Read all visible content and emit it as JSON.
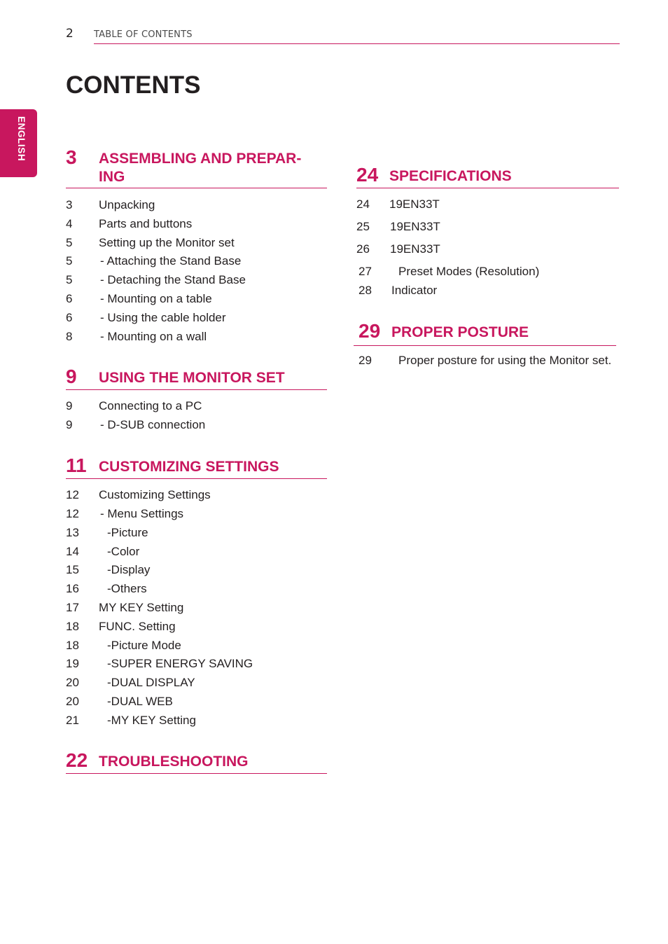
{
  "header": {
    "page_number": "2",
    "running_title": "TABLE OF CONTENTS"
  },
  "page_title": "CONTENTS",
  "language_tab": "ENGLISH",
  "accent_color": "#c8175e",
  "sections": [
    {
      "number": "3",
      "title_line1": "ASSEMBLING AND PREPAR-",
      "title_line2": "ING",
      "entries": [
        {
          "page": "3",
          "label": "Unpacking"
        },
        {
          "page": "4",
          "label": "Parts and buttons"
        },
        {
          "page": "5",
          "label": "Setting up the Monitor set"
        },
        {
          "page": "5",
          "label": "- Attaching the Stand Base"
        },
        {
          "page": "5",
          "label": "- Detaching the Stand Base"
        },
        {
          "page": "6",
          "label": "- Mounting on a table"
        },
        {
          "page": "6",
          "label": "- Using the cable holder"
        },
        {
          "page": "8",
          "label": "- Mounting on a wall"
        }
      ]
    },
    {
      "number": "9",
      "title_line1": "USING THE MONITOR SET",
      "entries": [
        {
          "page": "9",
          "label": "Connecting to a PC"
        },
        {
          "page": "9",
          "label": "- D-SUB connection"
        }
      ]
    },
    {
      "number": "11",
      "title_line1": "CUSTOMIZING SETTINGS",
      "entries": [
        {
          "page": "12",
          "label": "Customizing Settings"
        },
        {
          "page": "12",
          "label": "- Menu Settings"
        },
        {
          "page": "13",
          "label": "-Picture"
        },
        {
          "page": "14",
          "label": "-Color"
        },
        {
          "page": "15",
          "label": "-Display"
        },
        {
          "page": "16",
          "label": "-Others"
        },
        {
          "page": "17",
          "label": "MY KEY Setting"
        },
        {
          "page": "18",
          "label": "FUNC. Setting"
        },
        {
          "page": "18",
          "label": "-Picture Mode"
        },
        {
          "page": "19",
          "label": "-SUPER ENERGY SAVING"
        },
        {
          "page": "20",
          "label": "-DUAL DISPLAY"
        },
        {
          "page": "20",
          "label": "-DUAL WEB"
        },
        {
          "page": "21",
          "label": "-MY KEY Setting"
        }
      ]
    },
    {
      "number": "22",
      "title_line1": "TROUBLESHOOTING",
      "entries": []
    },
    {
      "number": "24",
      "title_line1": "SPECIFICATIONS",
      "entries": [
        {
          "page": "24",
          "label": "19EN33T"
        },
        {
          "page": "25",
          "label": "19EN33T"
        },
        {
          "page": "26",
          "label": "19EN33T"
        },
        {
          "page": "27",
          "label": "Preset Modes (Resolution)"
        },
        {
          "page": "28",
          "label": "Indicator"
        }
      ]
    },
    {
      "number": "29",
      "title_line1": "PROPER POSTURE",
      "entries": [
        {
          "page": "29",
          "label": "Proper posture for using the Monitor set."
        }
      ]
    }
  ]
}
